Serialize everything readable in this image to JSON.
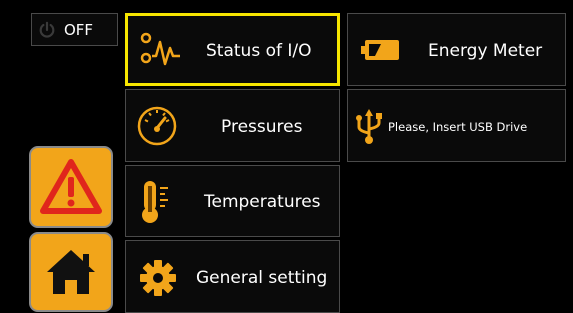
{
  "power": {
    "icon": "power-icon",
    "label": "OFF"
  },
  "menu": [
    {
      "id": "status-io",
      "label": "Status of I/O",
      "icon": "signal-wave-icon",
      "selected": true
    },
    {
      "id": "pressures",
      "label": "Pressures",
      "icon": "pressure-gauge-icon",
      "selected": false
    },
    {
      "id": "temperatures",
      "label": "Temperatures",
      "icon": "thermometer-icon",
      "selected": false
    },
    {
      "id": "general-setting",
      "label": "General setting",
      "icon": "gear-icon",
      "selected": false
    },
    {
      "id": "energy-meter",
      "label": "Energy Meter",
      "icon": "battery-icon",
      "selected": false
    },
    {
      "id": "usb",
      "label": "Please, Insert USB Drive",
      "icon": "usb-icon",
      "selected": false
    }
  ],
  "side": {
    "alarm_icon": "warning-icon",
    "home_icon": "home-icon"
  },
  "colors": {
    "accent": "#f2a51a",
    "selected_border": "#f7e600",
    "alarm_red": "#e0261c",
    "background": "#000000"
  }
}
